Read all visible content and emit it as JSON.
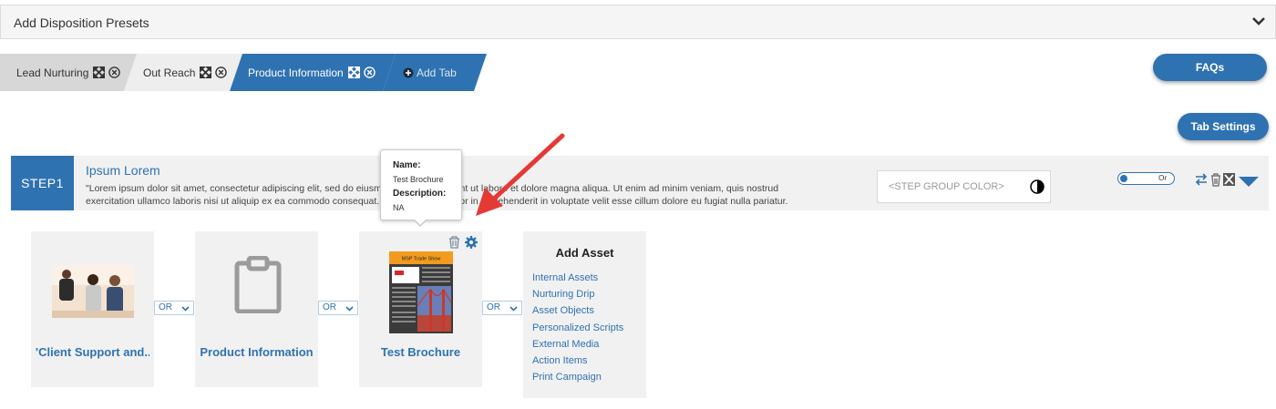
{
  "panel": {
    "title": "Add Disposition Presets",
    "collapse_icon": "chevron-down-icon"
  },
  "tabs": [
    {
      "label": "Lead Nurturing",
      "active": false
    },
    {
      "label": "Out Reach",
      "active": false
    },
    {
      "label": "Product Information",
      "active": true
    }
  ],
  "add_tab_label": "Add Tab",
  "buttons": {
    "faqs": "FAQs",
    "tab_settings": "Tab Settings"
  },
  "step": {
    "label": "STEP1",
    "title": "Ipsum Lorem",
    "description_line1": "\"Lorem ipsum dolor sit amet, consectetur adipiscing elit, sed do eiusmod tempor incididunt ut labore et dolore magna aliqua. Ut enim ad minim veniam, quis nostrud",
    "description_line2": "exercitation ullamco laboris nisi ut aliquip ex ea commodo consequat. Duis aute irure dolor in reprehenderit in voluptate velit esse cillum dolore eu fugiat nulla pariatur.",
    "color_placeholder": "<STEP GROUP COLOR>",
    "toggle_text": "Or"
  },
  "assets": [
    {
      "title": "'Client Support and..."
    },
    {
      "title": "Product Information"
    },
    {
      "title": "Test Brochure"
    }
  ],
  "or_label": "OR",
  "add_asset": {
    "title": "Add Asset",
    "items": [
      "Internal Assets",
      "Nurturing Drip",
      "Asset Objects",
      "Personalized Scripts",
      "External Media",
      "Action Items",
      "Print Campaign"
    ]
  },
  "tooltip": {
    "name_label": "Name:",
    "name_value": "Test Brochure",
    "desc_label": "Description:",
    "desc_value": "NA"
  },
  "brochure": {
    "header": "MSP Trade Show"
  },
  "colors": {
    "primary": "#2f72b1",
    "annotation": "#e53935"
  }
}
